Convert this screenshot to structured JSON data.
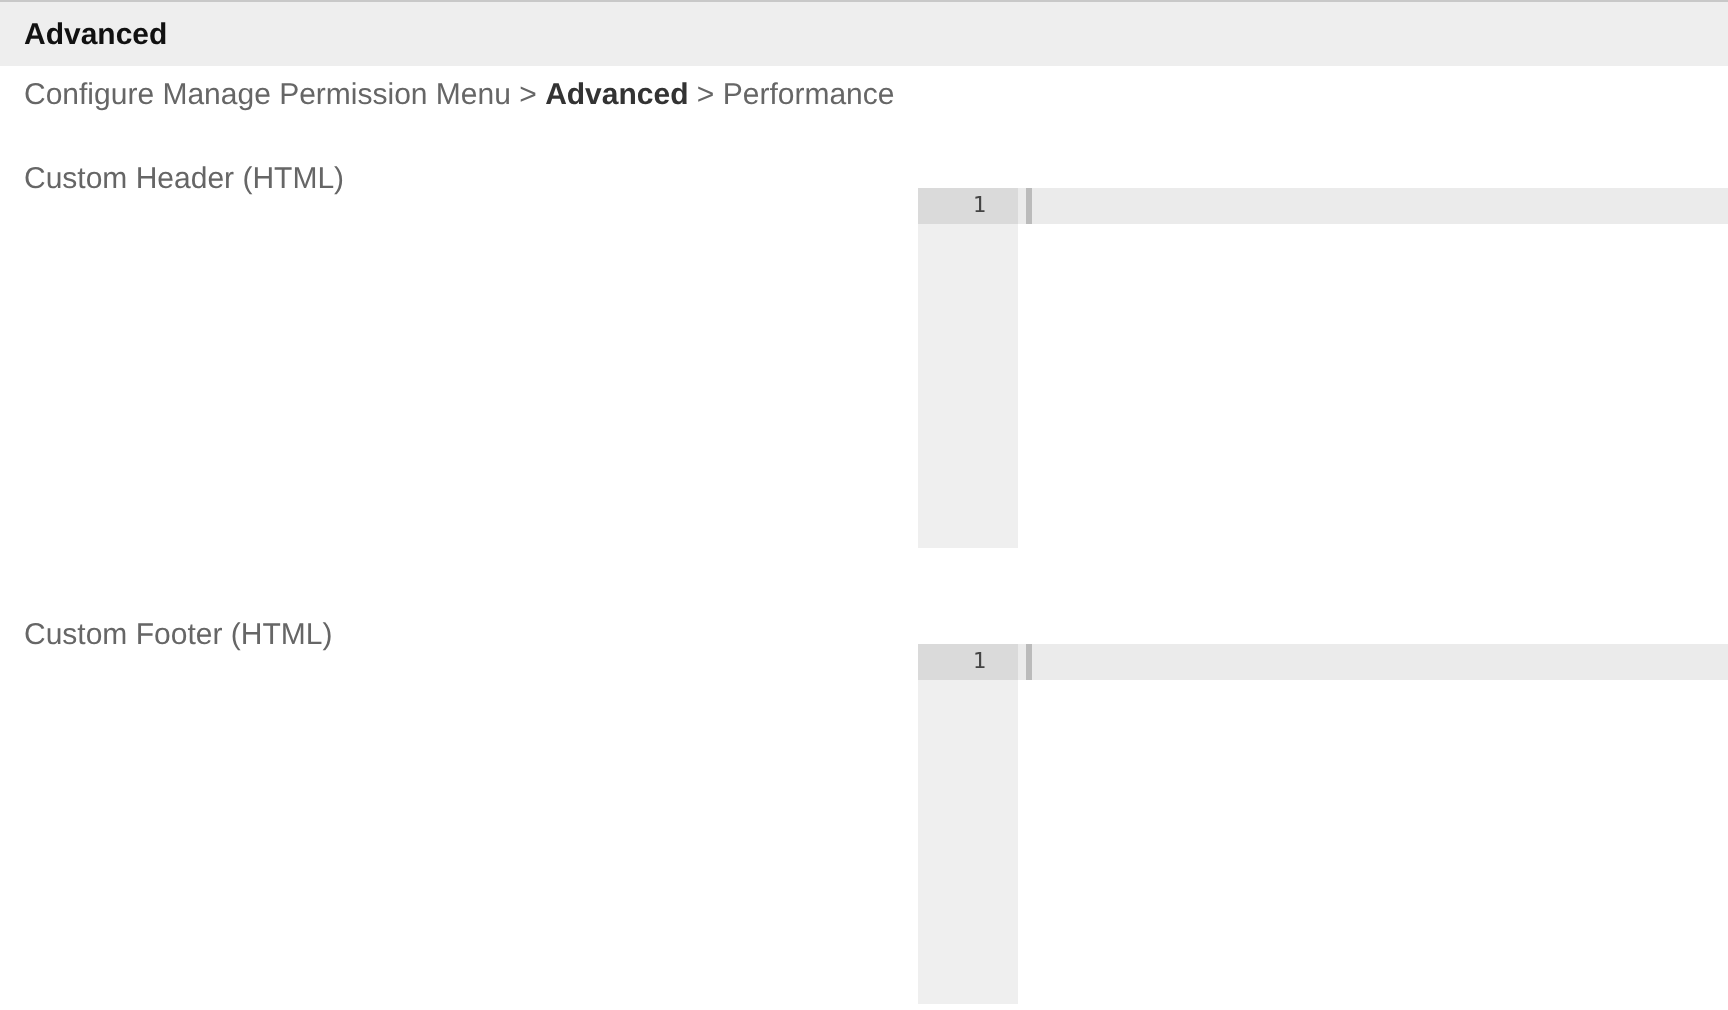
{
  "panel": {
    "title": "Advanced"
  },
  "breadcrumb": "Configure Manage Permission Menu > **Advanced** > Performance",
  "fields": [
    {
      "label": "Custom Header (HTML)",
      "editor": {
        "lines": [
          {
            "number": "1",
            "active": true
          }
        ]
      }
    },
    {
      "label": "Custom Footer (HTML)",
      "editor": {
        "lines": [
          {
            "number": "1",
            "active": true
          }
        ]
      }
    }
  ]
}
